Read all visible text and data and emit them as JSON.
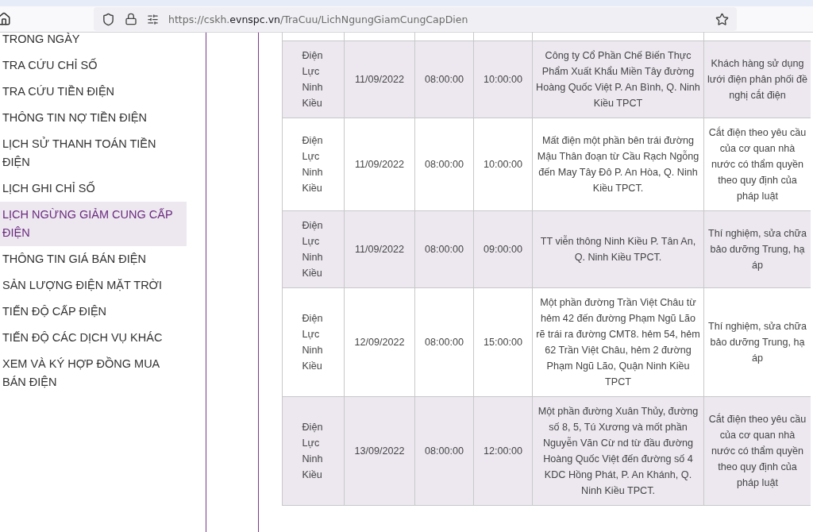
{
  "browser": {
    "url": "https://cskh.**evnspc.vn**/TraCuu/LichNgungGiamCungCapDien"
  },
  "sidebar": {
    "items": [
      {
        "label": "TRONG NGÀY",
        "selected": false
      },
      {
        "label": "TRA CỨU CHỈ SỐ",
        "selected": false
      },
      {
        "label": "TRA CỨU TIỀN ĐIỆN",
        "selected": false
      },
      {
        "label": "THÔNG TIN NỢ TIỀN ĐIỆN",
        "selected": false
      },
      {
        "label": "LỊCH SỬ THANH TOÁN TIỀN ĐIỆN",
        "selected": false
      },
      {
        "label": "LỊCH GHI CHỈ SỐ",
        "selected": false
      },
      {
        "label": "LỊCH NGỪNG GIẢM CUNG CẤP ĐIỆN",
        "selected": true
      },
      {
        "label": "THÔNG TIN GIÁ BÁN ĐIỆN",
        "selected": false
      },
      {
        "label": "SẢN LƯỢNG ĐIỆN MẶT TRỜI",
        "selected": false
      },
      {
        "label": "TIẾN ĐỘ CẤP ĐIỆN",
        "selected": false
      },
      {
        "label": "TIẾN ĐỘ CÁC DỊCH VỤ KHÁC",
        "selected": false
      },
      {
        "label": "XEM VÀ KÝ HỢP ĐỒNG MUA BÁN ĐIỆN",
        "selected": false
      }
    ]
  },
  "table": {
    "rows": [
      {
        "unit": "Điện Lực Ninh Kiều",
        "date": "11/09/2022",
        "start": "08:00:00",
        "end": "10:00:00",
        "area": "Công ty Cổ Phần Chế Biến Thực Phẩm Xuất Khẩu Miền Tây đường Hoàng Quốc Việt P. An Bình, Q. Ninh Kiều TPCT",
        "reason": "Khách hàng sử dụng lưới điện phân phối đề nghị cắt điện"
      },
      {
        "unit": "Điện Lực Ninh Kiều",
        "date": "11/09/2022",
        "start": "08:00:00",
        "end": "10:00:00",
        "area": "Mất điện một phần bên trái đường Mậu Thân đoạn từ Cầu Rạch Ngỗng đến May Tây Đô P. An Hòa, Q. Ninh Kiều TPCT.",
        "reason": "Cắt điện theo yêu cầu của cơ quan nhà nước có thẩm quyền theo quy định của pháp luật"
      },
      {
        "unit": "Điện Lực Ninh Kiều",
        "date": "11/09/2022",
        "start": "08:00:00",
        "end": "09:00:00",
        "area": "TT viễn thông Ninh Kiều P. Tân An, Q. Ninh Kiều TPCT.",
        "reason": "Thí nghiệm, sửa chữa bảo dưỡng Trung, hạ áp"
      },
      {
        "unit": "Điện Lực Ninh Kiều",
        "date": "12/09/2022",
        "start": "08:00:00",
        "end": "15:00:00",
        "area": "Một phần đường Trần Việt Châu từ hẻm 42 đến đường Phạm Ngũ Lão rẽ trái ra đường CMT8. hẻm 54, hẻm 62 Trần Việt Châu, hẻm 2 đường Phạm Ngũ Lão, Quận Ninh Kiều TPCT",
        "reason": "Thí nghiệm, sửa chữa bảo dưỡng Trung, hạ áp"
      },
      {
        "unit": "Điện Lực Ninh Kiều",
        "date": "13/09/2022",
        "start": "08:00:00",
        "end": "12:00:00",
        "area": "Một phần đường Xuân Thủy, đường số 8, 5, Tú Xương và mốt phần Nguyễn Văn Cừ nd từ đầu đường Hoàng Quốc Việt đến đường số 4 KDC Hồng Phát, P. An Khánh, Q. Ninh Kiều TPCT.",
        "reason": "Cắt điện theo yêu cầu của cơ quan nhà nước có thẩm quyền theo quy định của pháp luật"
      }
    ]
  }
}
